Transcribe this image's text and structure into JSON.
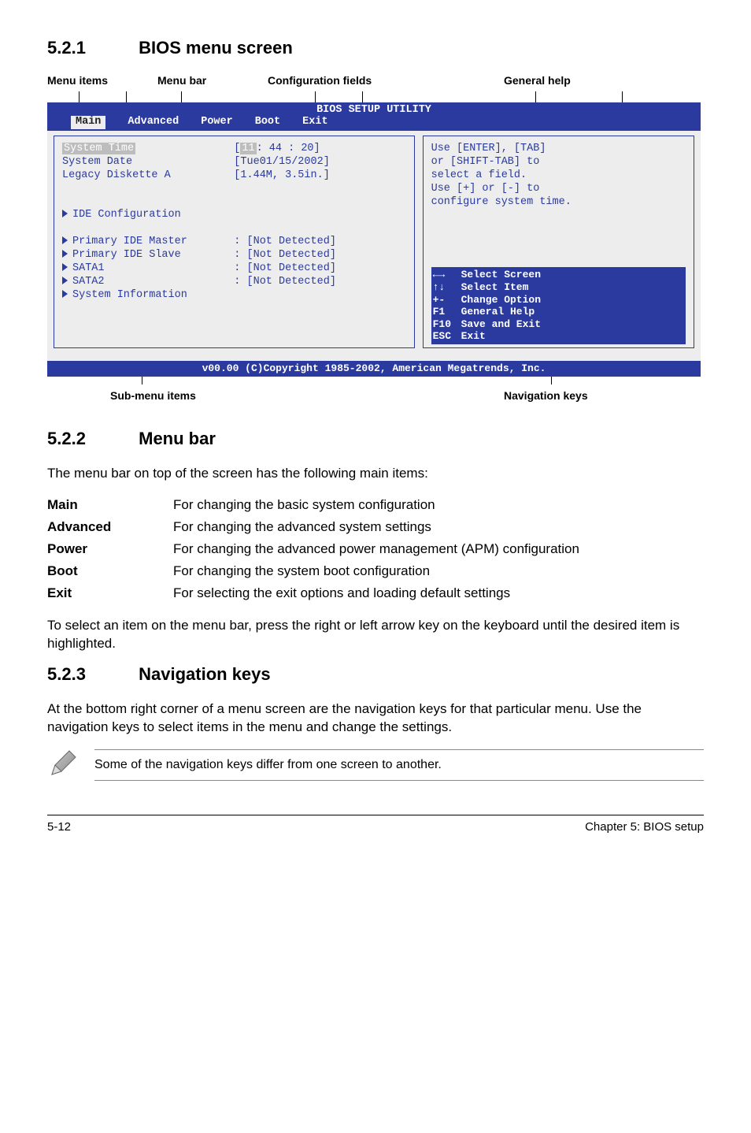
{
  "sections": {
    "s521": {
      "num": "5.2.1",
      "title": "BIOS menu screen"
    },
    "s522": {
      "num": "5.2.2",
      "title": "Menu bar"
    },
    "s523": {
      "num": "5.2.3",
      "title": "Navigation keys"
    }
  },
  "diagram": {
    "labels": {
      "menu_items": "Menu items",
      "menu_bar": "Menu bar",
      "config_fields": "Configuration fields",
      "general_help": "General help",
      "sub_menu": "Sub-menu items",
      "nav_keys": "Navigation keys"
    }
  },
  "bios": {
    "title": "BIOS SETUP UTILITY",
    "tabs": [
      "Main",
      "Advanced",
      "Power",
      "Boot",
      "Exit"
    ],
    "selected_tab": "Main",
    "rows": {
      "system_time": {
        "label": "System Time",
        "value_prefix": "[",
        "value_hour": "11",
        "value_rest": ": 44 : 20]"
      },
      "system_date": {
        "label": "System Date",
        "value": "[Tue01/15/2002]"
      },
      "legacy_diskette": {
        "label": "Legacy Diskette A",
        "value": "[1.44M, 3.5in.]"
      },
      "ide_config": {
        "label": "IDE Configuration"
      },
      "primary_master": {
        "label": "Primary IDE Master",
        "value": ": [Not Detected]"
      },
      "primary_slave": {
        "label": "Primary IDE Slave",
        "value": ": [Not Detected]"
      },
      "sata1": {
        "label": "SATA1",
        "value": ": [Not Detected]"
      },
      "sata2": {
        "label": "SATA2",
        "value": ": [Not Detected]"
      },
      "sys_info": {
        "label": "System Information"
      }
    },
    "help_text": [
      "Use [ENTER], [TAB]",
      "or [SHIFT-TAB] to",
      "select a field.",
      "Use [+] or [-] to",
      "configure system time."
    ],
    "legend": [
      {
        "k": "←→",
        "t": "Select Screen"
      },
      {
        "k": "↑↓",
        "t": "Select Item"
      },
      {
        "k": "+-",
        "t": "Change Option"
      },
      {
        "k": "F1",
        "t": "General Help"
      },
      {
        "k": "F10",
        "t": "Save and Exit"
      },
      {
        "k": "ESC",
        "t": "Exit"
      }
    ],
    "copyright": "v00.00 (C)Copyright 1985-2002, American Megatrends, Inc."
  },
  "menubar_text": {
    "intro": "The menu bar on top of the screen has the following main items:",
    "defs": [
      {
        "term": "Main",
        "desc": "For changing the basic system configuration"
      },
      {
        "term": "Advanced",
        "desc": "For changing the advanced system settings"
      },
      {
        "term": "Power",
        "desc": "For changing the advanced power management (APM) configuration"
      },
      {
        "term": "Boot",
        "desc": "For changing the system boot configuration"
      },
      {
        "term": "Exit",
        "desc": "For selecting the exit options and loading default settings"
      }
    ],
    "outro": "To select an item on the menu bar, press the right or left arrow key on the keyboard until the desired item is highlighted."
  },
  "navkeys_text": {
    "intro": "At the bottom right corner of a menu screen are the navigation keys for that particular menu. Use the navigation keys to select items in the menu and change the settings.",
    "note": "Some of the navigation keys differ from one screen to another."
  },
  "footer": {
    "left": "5-12",
    "right": "Chapter 5: BIOS setup"
  }
}
